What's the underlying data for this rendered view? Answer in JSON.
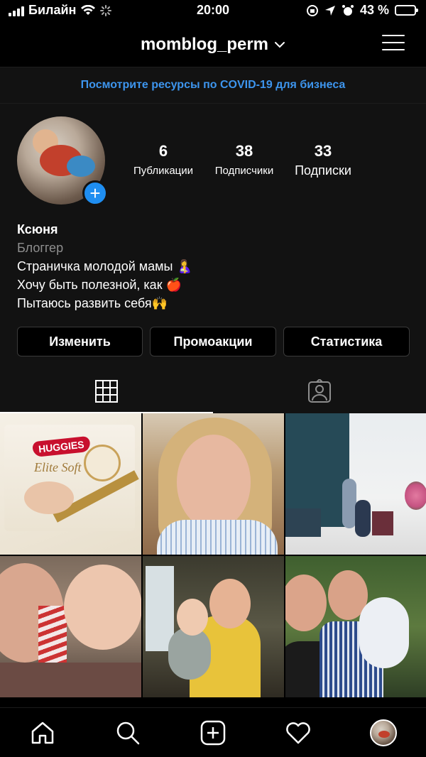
{
  "status_bar": {
    "carrier": "Билайн",
    "time": "20:00",
    "battery_percent": "43 %",
    "battery_level": 0.43
  },
  "header": {
    "username": "momblog_perm",
    "dropdown_icon": "chevron-down-icon",
    "menu_icon": "hamburger-menu-icon"
  },
  "banner": {
    "text": "Посмотрите ресурсы по COVID-19 для бизнеса",
    "color": "#3d95ee"
  },
  "profile": {
    "stats": [
      {
        "value": "6",
        "label": "Публикации"
      },
      {
        "value": "38",
        "label": "Подписчики"
      },
      {
        "value": "33",
        "label": "Подписки"
      }
    ],
    "name": "Ксюня",
    "category": "Блоггер",
    "bio_lines": [
      "Страничка молодой мамы 🤱",
      "Хочу быть полезной, как 🍎",
      "Пытаюсь развить себя🙌"
    ]
  },
  "actions": {
    "edit": "Изменить",
    "promotions": "Промоакции",
    "statistics": "Статистика"
  },
  "tabs": [
    {
      "icon": "grid-icon",
      "active": true
    },
    {
      "icon": "tagged-person-icon",
      "active": false
    }
  ],
  "posts": {
    "c1": {
      "brand": "HUGGIES",
      "sub": "Elite Soft"
    }
  },
  "bottom_nav": [
    {
      "icon": "home-icon"
    },
    {
      "icon": "search-icon"
    },
    {
      "icon": "add-post-icon"
    },
    {
      "icon": "heart-icon"
    },
    {
      "icon": "profile-avatar"
    }
  ],
  "colors": {
    "background": "#000000",
    "surface": "#121212",
    "link_blue": "#3d95ee",
    "story_add_blue": "#1f8ef1"
  }
}
